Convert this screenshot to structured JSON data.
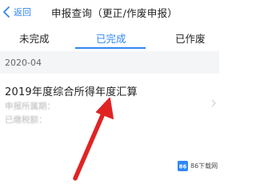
{
  "header": {
    "back_label": "返回",
    "title": "申报查询（更正/作废申报）"
  },
  "tabs": [
    {
      "label": "未完成",
      "active": false
    },
    {
      "label": "已完成",
      "active": true
    },
    {
      "label": "已作废",
      "active": false
    }
  ],
  "section": {
    "date": "2020-04"
  },
  "record": {
    "title": "2019年度综合所得年度汇算",
    "line1": "申报所属期：",
    "line2": "已缴税额："
  },
  "watermark": {
    "logo_text": "86",
    "text": "86下载网"
  },
  "colors": {
    "accent": "#2f86f6",
    "annotation_arrow": "#e02424",
    "section_background": "#f4f5f7"
  },
  "icons": {
    "back": "chevron-left-icon",
    "record_chevron": "chevron-right-icon"
  }
}
